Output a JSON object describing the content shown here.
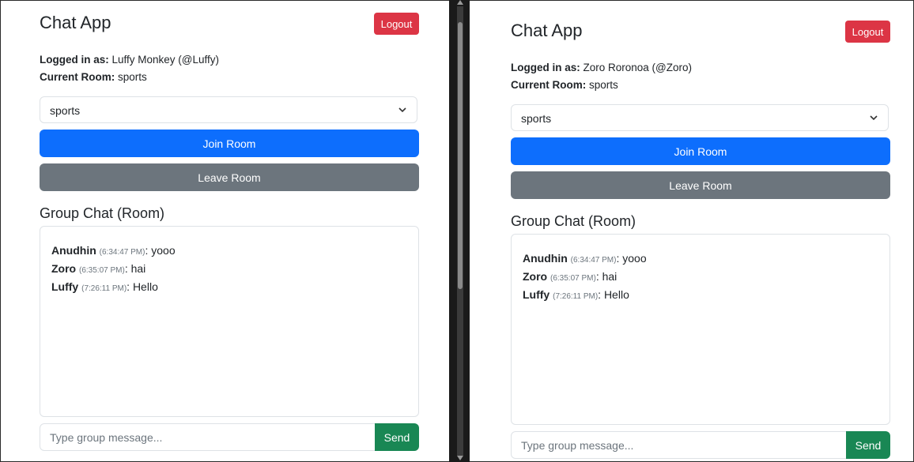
{
  "left_window": {
    "app_title": "Chat App",
    "logout_label": "Logout",
    "logged_in_label": "Logged in as:",
    "logged_in_value": "Luffy Monkey (@Luffy)",
    "current_room_label": "Current Room:",
    "current_room_value": "sports",
    "room_select_value": "sports",
    "join_label": "Join Room",
    "leave_label": "Leave Room",
    "group_chat_title": "Group Chat (Room)",
    "messages": [
      {
        "user": "Anudhin",
        "time": "(6:34:47 PM)",
        "text": ": yooo"
      },
      {
        "user": "Zoro",
        "time": "(6:35:07 PM)",
        "text": ": hai"
      },
      {
        "user": "Luffy",
        "time": "(7:26:11 PM)",
        "text": ": Hello"
      }
    ],
    "input_placeholder": "Type group message...",
    "send_label": "Send"
  },
  "right_window": {
    "app_title": "Chat App",
    "logout_label": "Logout",
    "logged_in_label": "Logged in as:",
    "logged_in_value": "Zoro Roronoa (@Zoro)",
    "current_room_label": "Current Room:",
    "current_room_value": "sports",
    "room_select_value": "sports",
    "join_label": "Join Room",
    "leave_label": "Leave Room",
    "group_chat_title": "Group Chat (Room)",
    "messages": [
      {
        "user": "Anudhin",
        "time": "(6:34:47 PM)",
        "text": ": yooo"
      },
      {
        "user": "Zoro",
        "time": "(6:35:07 PM)",
        "text": ": hai"
      },
      {
        "user": "Luffy",
        "time": "(7:26:11 PM)",
        "text": ": Hello"
      }
    ],
    "input_placeholder": "Type group message...",
    "send_label": "Send"
  },
  "colors": {
    "logout": "#dc3545",
    "join": "#0d6efd",
    "leave": "#6c757d",
    "send": "#198754"
  },
  "icons": {
    "select_chevron": "chevron-down-icon"
  }
}
